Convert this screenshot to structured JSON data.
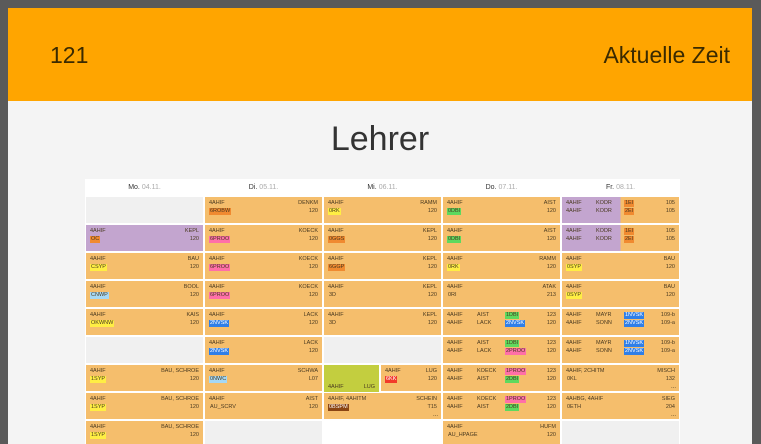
{
  "header": {
    "room": "121",
    "clock_label": "Aktuelle Zeit"
  },
  "title": "Lehrer",
  "days": [
    {
      "name": "Mo.",
      "date": "04.11."
    },
    {
      "name": "Di.",
      "date": "05.11."
    },
    {
      "name": "Mi.",
      "date": "06.11."
    },
    {
      "name": "Do.",
      "date": "07.11."
    },
    {
      "name": "Fr.",
      "date": "08.11."
    }
  ],
  "more_indicator": "...",
  "colors": {
    "topbar": "#ffa500",
    "cell": "#f5be6c",
    "purple": "#c3a5cf",
    "green": "#c3ce3f",
    "chip_yellow": "#ffee44",
    "chip_orange": "#f08a30",
    "chip_green": "#5ed95e",
    "chip_pink": "#ff6fa8",
    "chip_red": "#f23a2a",
    "chip_blue": "#2f7fe8",
    "chip_lightblue": "#a5d8f5",
    "chip_brown": "#8b4513"
  },
  "cells": {
    "mo": [
      null,
      {
        "kind": "purple",
        "l1": "4AHIF",
        "r1": "KEPL",
        "l2": "OC",
        "r2": "120",
        "chip": "chip_orange"
      },
      {
        "kind": "normal",
        "l1": "4AHIF",
        "r1": "BAU",
        "l2": "CSYP",
        "r2": "120",
        "chip": "chip_yellow"
      },
      {
        "kind": "normal",
        "l1": "4AHIF",
        "r1": "BOOL",
        "l2": "CNWP",
        "r2": "120",
        "chip": "chip_lightblue"
      },
      {
        "kind": "normal",
        "l1": "4AHIF",
        "r1": "KAIS",
        "l2": "OKWNW",
        "r2": "120",
        "chip": "chip_yellow"
      },
      null,
      {
        "kind": "normal",
        "l1": "4AHIF",
        "r1": "BAU, SCHROE",
        "l2": "1SYP",
        "r2": "120",
        "chip": "chip_yellow"
      },
      {
        "kind": "normal",
        "l1": "4AHIF",
        "r1": "BAU, SCHROE",
        "l2": "1SYP",
        "r2": "120",
        "chip": "chip_yellow"
      },
      {
        "kind": "normal",
        "l1": "4AHIF",
        "r1": "BAU, SCHROE",
        "l2": "1SYP",
        "r2": "120",
        "chip": "chip_yellow"
      }
    ],
    "di": [
      {
        "kind": "normal",
        "l1": "4AHIF",
        "r1": "DENKM",
        "l2": "6ROBW",
        "r2": "120",
        "chip": "chip_orange"
      },
      {
        "kind": "normal",
        "l1": "4AHIF",
        "r1": "KOECK",
        "l2": "6PROO",
        "r2": "120",
        "chip": "chip_pink"
      },
      {
        "kind": "normal",
        "l1": "4AHIF",
        "r1": "KOECK",
        "l2": "6PROO",
        "r2": "120",
        "chip": "chip_pink"
      },
      {
        "kind": "normal",
        "l1": "4AHIF",
        "r1": "KOECK",
        "l2": "6PROO",
        "r2": "120",
        "chip": "chip_pink"
      },
      {
        "kind": "normal",
        "l1": "4AHIF",
        "r1": "LACK",
        "l2": "2NVSK",
        "r2": "120",
        "chip": "chip_blue"
      },
      {
        "kind": "normal",
        "l1": "4AHIF",
        "r1": "LACK",
        "l2": "2NVSK",
        "r2": "120",
        "chip": "chip_blue"
      },
      {
        "kind": "normal",
        "l1": "4AHIF",
        "r1": "SCHWA",
        "l2": "0NWC",
        "r2": "L07",
        "chip": "chip_lightblue"
      },
      {
        "kind": "normal",
        "l1": "4AHIF",
        "r1": "AIST",
        "l2": "AU_SCRV",
        "r2": "120",
        "chip": null
      },
      null
    ],
    "mi": [
      {
        "kind": "normal",
        "l1": "4AHIF",
        "r1": "RAMM",
        "l2": "0RK",
        "r2": "120",
        "chip": "chip_yellow"
      },
      {
        "kind": "normal",
        "l1": "4AHIF",
        "r1": "KEPL",
        "l2": "0GGS",
        "r2": "120",
        "chip": "chip_orange"
      },
      {
        "kind": "normal",
        "l1": "4AHIF",
        "r1": "KEPL",
        "l2": "6GGP",
        "r2": "120",
        "chip": "chip_orange"
      },
      {
        "kind": "normal",
        "l1": "4AHIF",
        "r1": "KEPL",
        "l2": "3D",
        "r2": "120",
        "chip": null
      },
      {
        "kind": "normal",
        "l1": "4AHIF",
        "r1": "KEPL",
        "l2": "3D",
        "r2": "120",
        "chip": null
      },
      null,
      {
        "kind": "split",
        "green": {
          "l1": "4AHIF",
          "r1": "LUG",
          "l2": "FXI"
        },
        "a": {
          "l1": "4AHIF",
          "r1": "LUG",
          "l2": "6KK",
          "r2": "120",
          "chip": "chip_red"
        },
        "b": {
          "l1": "4AHIF",
          "r1": "LUG",
          "l2": "6KK",
          "r2": "120",
          "chip": "chip_red"
        }
      },
      {
        "kind": "normal",
        "l1": "4AHIF, 4AHITM",
        "r1": "SCHEIN",
        "l2": "0BSPM",
        "r2": "T15",
        "chip": "chip_brown",
        "more": true
      }
    ],
    "do": [
      {
        "kind": "normal",
        "l1": "4AHIF",
        "r1": "AIST",
        "l2": "0DBI",
        "r2": "120",
        "chip": "chip_green"
      },
      {
        "kind": "normal",
        "l1": "4AHIF",
        "r1": "AIST",
        "l2": "0DBI",
        "r2": "120",
        "chip": "chip_green"
      },
      {
        "kind": "normal",
        "l1": "4AHIF",
        "r1": "RAMM",
        "l2": "0RK",
        "r2": "120",
        "chip": "chip_yellow"
      },
      {
        "kind": "normal",
        "l1": "4AHIF",
        "r1": "ATAK",
        "l2": "0RI",
        "r2": "213",
        "chip": null
      },
      {
        "kind": "quad",
        "rows": [
          {
            "c": "4AHIF",
            "t": "AIST",
            "s": "1DBI",
            "r": "123",
            "chip": "chip_green"
          },
          {
            "c": "4AHIF",
            "t": "LACK",
            "s": "2NVSK",
            "r": "120",
            "chip": "chip_blue"
          }
        ]
      },
      {
        "kind": "quad",
        "rows": [
          {
            "c": "4AHIF",
            "t": "AIST",
            "s": "1DBI",
            "r": "123",
            "chip": "chip_green"
          },
          {
            "c": "4AHIF",
            "t": "LACK",
            "s": "2PROO",
            "r": "120",
            "chip": "chip_pink"
          }
        ]
      },
      {
        "kind": "quad",
        "rows": [
          {
            "c": "4AHIF",
            "t": "KOECK",
            "s": "1PROO",
            "r": "123",
            "chip": "chip_pink"
          },
          {
            "c": "4AHIF",
            "t": "AIST",
            "s": "2DBI",
            "r": "120",
            "chip": "chip_green"
          }
        ]
      },
      {
        "kind": "quad",
        "rows": [
          {
            "c": "4AHIF",
            "t": "KOECK",
            "s": "1PROO",
            "r": "123",
            "chip": "chip_pink"
          },
          {
            "c": "4AHIF",
            "t": "AIST",
            "s": "2DBI",
            "r": "120",
            "chip": "chip_green"
          }
        ]
      },
      {
        "kind": "normal",
        "l1": "4AHIF",
        "r1": "HUFM",
        "l2": "AU_HPAGE",
        "r2": "120",
        "chip": null
      }
    ],
    "fr": [
      {
        "kind": "quad2",
        "rows": [
          {
            "c": "4AHIF",
            "t": "KODR",
            "s": "1EI",
            "r": "105",
            "chip": "chip_orange"
          },
          {
            "c": "4AHIF",
            "t": "KODR",
            "s": "2EI",
            "r": "105",
            "chip": "chip_orange"
          }
        ]
      },
      {
        "kind": "quad2",
        "rows": [
          {
            "c": "4AHIF",
            "t": "KODR",
            "s": "1EI",
            "r": "105",
            "chip": "chip_orange"
          },
          {
            "c": "4AHIF",
            "t": "KODR",
            "s": "2EI",
            "r": "105",
            "chip": "chip_orange"
          }
        ]
      },
      {
        "kind": "normal",
        "l1": "4AHIF",
        "r1": "BAU",
        "l2": "0SYP",
        "r2": "120",
        "chip": "chip_yellow"
      },
      {
        "kind": "normal",
        "l1": "4AHIF",
        "r1": "BAU",
        "l2": "0SYP",
        "r2": "120",
        "chip": "chip_yellow"
      },
      {
        "kind": "quad",
        "rows": [
          {
            "c": "4AHIF",
            "t": "MAYR",
            "s": "1NVSK",
            "r": "109-b",
            "chip": "chip_blue"
          },
          {
            "c": "4AHIF",
            "t": "SONN",
            "s": "2NVSK",
            "r": "109-a",
            "chip": "chip_blue"
          }
        ]
      },
      {
        "kind": "quad",
        "rows": [
          {
            "c": "4AHIF",
            "t": "MAYR",
            "s": "1NVSK",
            "r": "109-b",
            "chip": "chip_blue"
          },
          {
            "c": "4AHIF",
            "t": "SONN",
            "s": "2NVSK",
            "r": "109-a",
            "chip": "chip_blue"
          }
        ]
      },
      {
        "kind": "normal",
        "l1": "4AHIF, 2CHITM",
        "r1": "MISCH",
        "l2": "0KL",
        "r2": "132",
        "chip": null,
        "more": true
      },
      {
        "kind": "normal",
        "l1": "4AHBG, 4AHIF",
        "r1": "SIEG",
        "l2": "0ETH",
        "r2": "204",
        "chip": null,
        "more": true
      },
      null
    ]
  }
}
